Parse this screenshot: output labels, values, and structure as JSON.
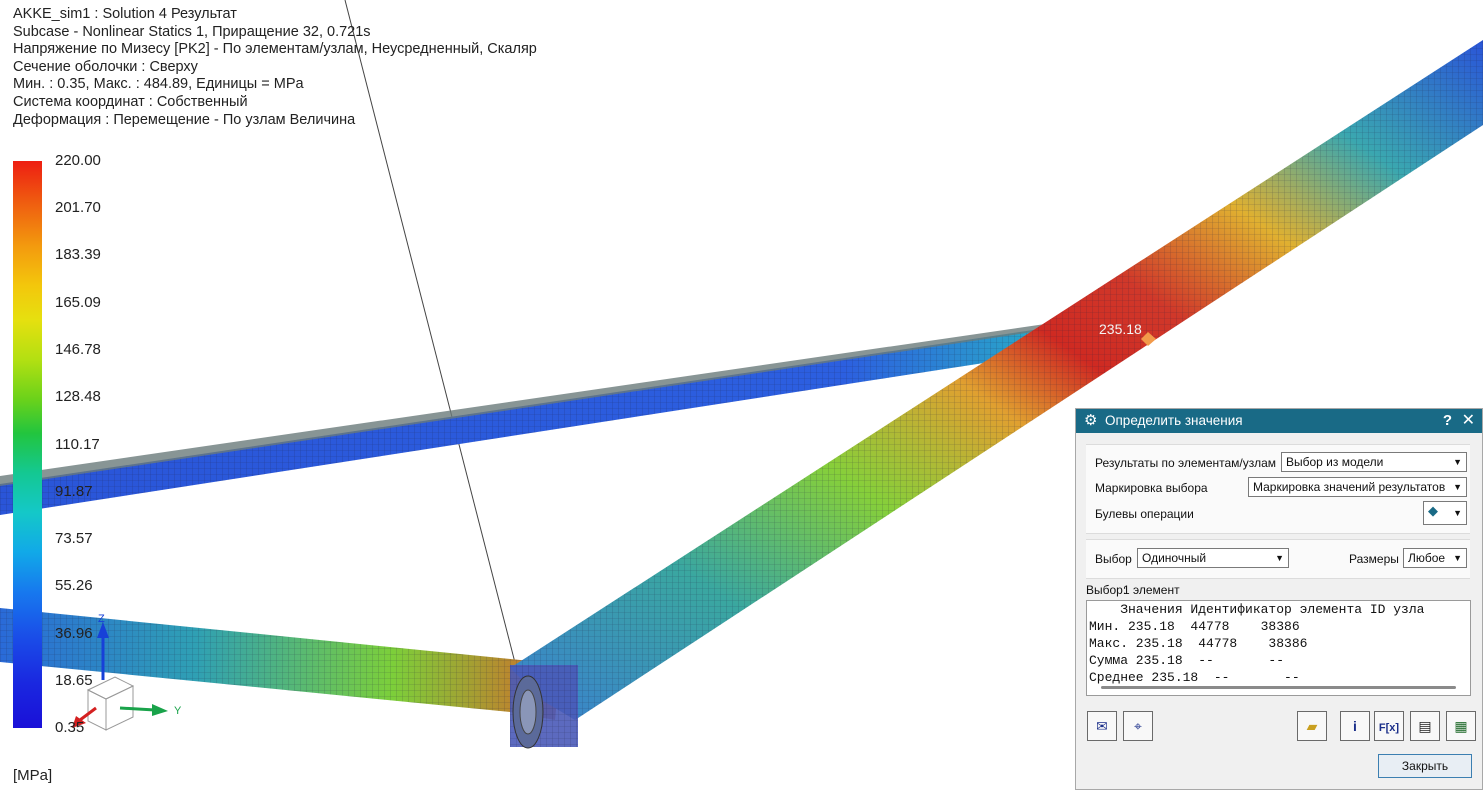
{
  "header": {
    "line1": "AKKE_sim1 : Solution 4 Результат",
    "line2": "Subcase - Nonlinear Statics 1, Приращение 32, 0.721s",
    "line3": "Напряжение по Мизесу [PK2] - По элементам/узлам, Неусредненный, Скаляр",
    "line4": "Сечение оболочки : Сверху",
    "line5": "Мин. : 0.35, Макс. : 484.89, Единицы = MPa",
    "line6": "Система координат : Собственный",
    "line7": "Деформация : Перемещение - По узлам Величина"
  },
  "legend": {
    "ticks": [
      "220.00",
      "201.70",
      "183.39",
      "165.09",
      "146.78",
      "128.48",
      "110.17",
      "91.87",
      "73.57",
      "55.26",
      "36.96",
      "18.65",
      "0.35"
    ],
    "unit": "[MPa]"
  },
  "triad": {
    "z": "Z",
    "y": "Y"
  },
  "pick_value": "235.18",
  "dialog": {
    "title": "Определить значения",
    "help": "?",
    "close": "✕",
    "results_label": "Результаты по элементам/узлам",
    "results_value": "Выбор из модели",
    "marking_label": "Маркировка выбора",
    "marking_value": "Маркировка значений результатов",
    "boolean_label": "Булевы операции",
    "select_label": "Выбор",
    "select_value": "Одиночный",
    "size_label": "Размеры",
    "size_value": "Любое",
    "selection_label": "Выбор:",
    "selection_count": "1 элемент",
    "table_header": "    Значения Идентификатор элемента ID узла",
    "rows": [
      "Мин. 235.18  44778    38386",
      "Макс. 235.18  44778    38386",
      "Сумма 235.18  --       --",
      "Среднее 235.18  --       --"
    ],
    "close_button": "Закрыть"
  },
  "colors": {
    "title_bar": "#196a86",
    "accent_red": "#ee1e12",
    "accent_blue": "#1a10d8"
  }
}
